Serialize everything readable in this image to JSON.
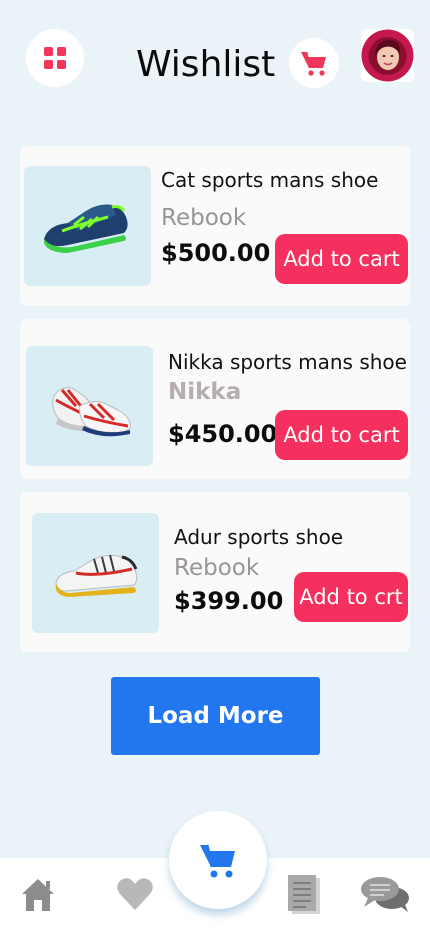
{
  "header": {
    "title": "Wishlist",
    "menu_icon": "grid-menu-icon",
    "cart_icon": "cart-icon",
    "avatar": "user-avatar"
  },
  "products": [
    {
      "name": "Cat sports mans shoe",
      "brand": "Rebook",
      "price": "$500.00",
      "button_label": "Add to cart",
      "image": "green-sneaker"
    },
    {
      "name": "Nikka sports mans shoe",
      "brand": "Nikka",
      "price": "$450.00",
      "button_label": "Add to cart",
      "image": "red-white-sneaker-pair"
    },
    {
      "name": "Adur sports shoe",
      "brand": "Rebook",
      "price": "$399.00",
      "button_label": "Add to crt",
      "image": "white-red-sneaker"
    }
  ],
  "load_more_label": "Load More",
  "bottom_nav": {
    "items": [
      "home-icon",
      "heart-icon",
      "cart-icon",
      "document-icon",
      "chat-icon"
    ],
    "active": "cart-icon"
  },
  "colors": {
    "accent": "#f5305e",
    "primary_button": "#2277ee",
    "background": "#e9f3f8",
    "card": "#fafafa",
    "thumb": "#d9edf5"
  }
}
